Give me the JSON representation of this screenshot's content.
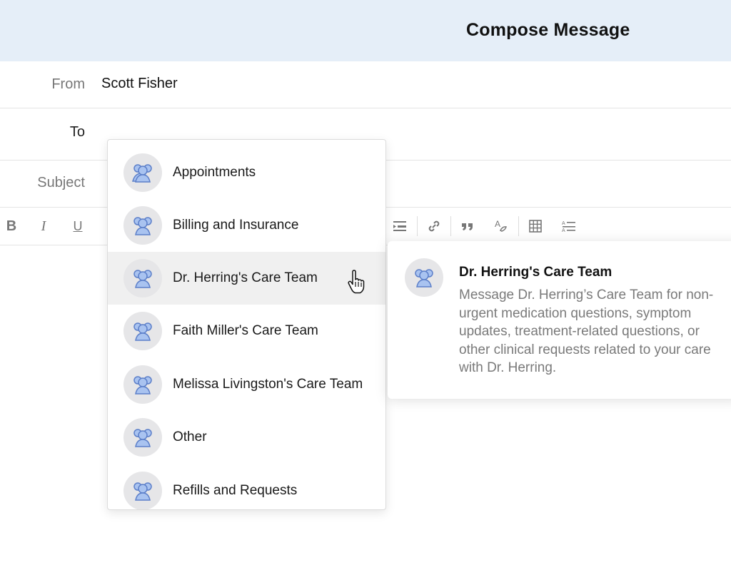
{
  "header": {
    "title": "Compose Message"
  },
  "form": {
    "from_label": "From",
    "from_value": "Scott Fisher",
    "to_label": "To",
    "subject_label": "Subject"
  },
  "toolbar": {
    "bold": "B",
    "italic": "I",
    "underline": "U",
    "buttons": [
      "bold-button",
      "italic-button",
      "underline-button",
      "indent-button",
      "link-button",
      "quote-button",
      "spell-check-button",
      "table-button",
      "list-button"
    ]
  },
  "recipients": {
    "items": [
      {
        "label": "Appointments",
        "icon": "group-icon"
      },
      {
        "label": "Billing and Insurance",
        "icon": "group-icon"
      },
      {
        "label": "Dr. Herring's Care Team",
        "icon": "group-icon",
        "hovered": true
      },
      {
        "label": "Faith Miller's Care Team",
        "icon": "group-icon"
      },
      {
        "label": "Melissa Livingston's Care Team",
        "icon": "group-icon"
      },
      {
        "label": "Other",
        "icon": "group-icon"
      },
      {
        "label": "Refills and Requests",
        "icon": "group-icon"
      }
    ]
  },
  "tooltip": {
    "title": "Dr. Herring's Care Team",
    "description": "Message Dr. Herring’s Care Team for non-urgent medication questions, symptom updates, treatment-related questions, or other clinical requests related to your care with Dr. Herring."
  },
  "colors": {
    "header_bg": "#e5eef8",
    "avatar_bg": "#e6e6e8",
    "icon_fill": "#a9c3f0",
    "icon_stroke": "#5c7fc9",
    "hover_bg": "#f0f0f0"
  }
}
